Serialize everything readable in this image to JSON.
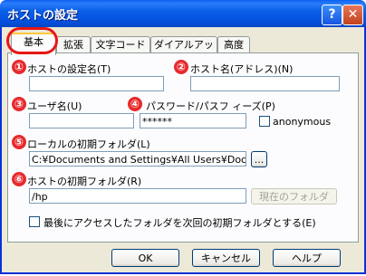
{
  "window": {
    "title": "ホストの設定",
    "help_label": "?",
    "close_label": "✕"
  },
  "tabs": [
    {
      "label": "基本",
      "active": true
    },
    {
      "label": "拡張"
    },
    {
      "label": "文字コード"
    },
    {
      "label": "ダイアルアップ"
    },
    {
      "label": "高度"
    }
  ],
  "markers": [
    "①",
    "②",
    "③",
    "④",
    "⑤",
    "⑥"
  ],
  "fields": {
    "setting_name": {
      "label": "ホストの設定名(T)",
      "value": ""
    },
    "host_name": {
      "label": "ホスト名(アドレス)(N)",
      "value": ""
    },
    "user_name": {
      "label": "ユーザ名(U)",
      "value": ""
    },
    "password": {
      "label": "パスワード/パスフ ィーズ(P)",
      "value": "******"
    },
    "anonymous": {
      "label": "anonymous",
      "checked": false
    },
    "local_folder": {
      "label": "ローカルの初期フォルダ(L)",
      "value": "C:¥Documents and Settings¥All Users¥Docum",
      "browse_label": "..."
    },
    "host_folder": {
      "label": "ホストの初期フォルダ(R)",
      "value": "/hp",
      "current_label": "現在のフォルダ"
    },
    "remember_last": {
      "label": "最後にアクセスしたフォルダを次回の初期フォルダとする(E)",
      "checked": false
    }
  },
  "buttons": {
    "ok": "OK",
    "cancel": "キャンセル",
    "help": "ヘルプ"
  },
  "colors": {
    "title_bar": "#0a5fe8",
    "marker": "#e8292c",
    "highlight": "#e81616"
  }
}
